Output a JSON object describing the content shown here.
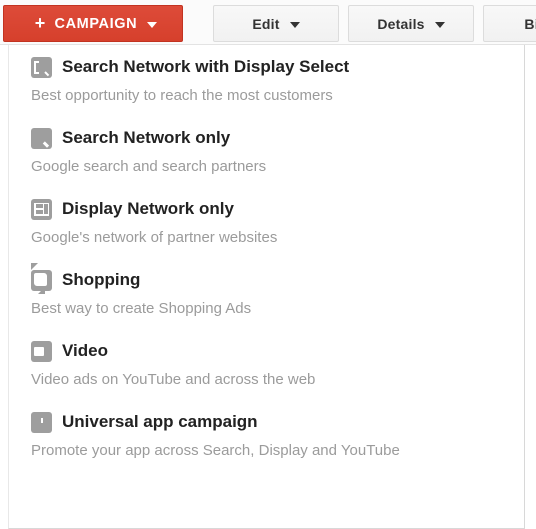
{
  "toolbar": {
    "campaign_button": {
      "label": "CAMPAIGN",
      "plus_glyph": "+",
      "icon": "plus-icon",
      "caret_icon": "caret-down-icon",
      "color": "#dd4b39"
    },
    "buttons": [
      {
        "label": "Edit",
        "caret_icon": "caret-down-icon"
      },
      {
        "label": "Details",
        "caret_icon": "caret-down-icon"
      },
      {
        "label": "Bid",
        "caret_icon": "caret-down-icon"
      }
    ]
  },
  "dropdown": {
    "items": [
      {
        "icon": "search-display-select-icon",
        "title": "Search Network with Display Select",
        "description": "Best opportunity to reach the most customers"
      },
      {
        "icon": "search-icon",
        "title": "Search Network only",
        "description": "Google search and search partners"
      },
      {
        "icon": "display-network-layout-icon",
        "title": "Display Network only",
        "description": "Google's network of partner websites"
      },
      {
        "icon": "price-tag-icon",
        "title": "Shopping",
        "description": "Best way to create Shopping Ads"
      },
      {
        "icon": "video-camera-icon",
        "title": "Video",
        "description": "Video ads on YouTube and across the web"
      },
      {
        "icon": "download-circle-icon",
        "title": "Universal app campaign",
        "description": "Promote your app across Search, Display and YouTube"
      }
    ]
  },
  "colors": {
    "accent_red": "#dd4b39",
    "icon_grey": "#9e9e9e",
    "title_text": "#222222",
    "desc_text": "#9b9b9b",
    "button_grey": "#f1f1f1"
  }
}
